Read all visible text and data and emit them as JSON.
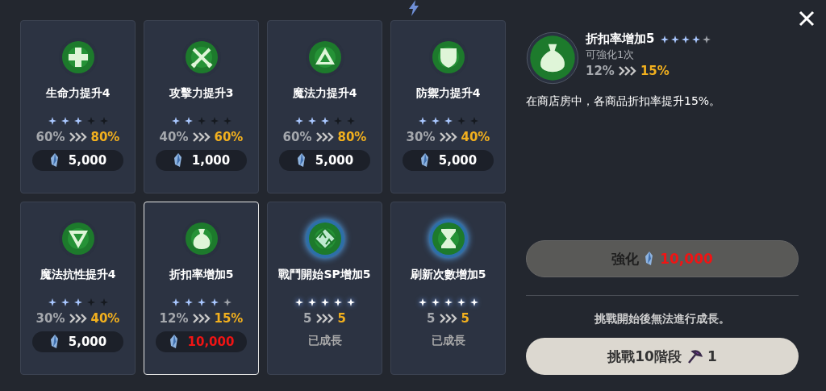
{
  "cards": [
    {
      "kind": "cost",
      "name": "生命力提升4",
      "stars": 3,
      "from": "60%",
      "to": "80%",
      "cost": "5,000",
      "affordable": true,
      "selected": false
    },
    {
      "kind": "cost",
      "name": "攻擊力提升3",
      "stars": 2,
      "from": "40%",
      "to": "60%",
      "cost": "1,000",
      "affordable": true,
      "selected": false
    },
    {
      "kind": "cost",
      "name": "魔法力提升4",
      "stars": 3,
      "from": "60%",
      "to": "80%",
      "cost": "5,000",
      "affordable": true,
      "selected": false
    },
    {
      "kind": "cost",
      "name": "防禦力提升4",
      "stars": 3,
      "from": "30%",
      "to": "40%",
      "cost": "5,000",
      "affordable": true,
      "selected": false
    },
    {
      "kind": "cost",
      "name": "魔法抗性提升4",
      "stars": 3,
      "from": "30%",
      "to": "40%",
      "cost": "5,000",
      "affordable": true,
      "selected": false
    },
    {
      "kind": "cost",
      "name": "折扣率增加5",
      "stars": 4,
      "from": "12%",
      "to": "15%",
      "cost": "10,000",
      "affordable": false,
      "selected": true
    },
    {
      "kind": "done",
      "name": "戰鬥開始SP增加5",
      "stars": 5,
      "from": "5",
      "to": "5",
      "status": "已成長",
      "selected": false
    },
    {
      "kind": "done",
      "name": "刷新次數增加5",
      "stars": 5,
      "from": "5",
      "to": "5",
      "status": "已成長",
      "selected": false
    }
  ],
  "detail": {
    "name": "折扣率增加5",
    "stars": 4,
    "subtitle": "可強化1次",
    "from": "12%",
    "to": "15%",
    "description": "在商店房中，各商品折扣率提升15%。"
  },
  "enhance_button": {
    "label": "強化",
    "cost": "10,000",
    "disabled": true,
    "affordable": false
  },
  "note": "挑戰開始後無法進行成長。",
  "challenge_button": {
    "label": "挑戰10階段",
    "count": "1"
  }
}
